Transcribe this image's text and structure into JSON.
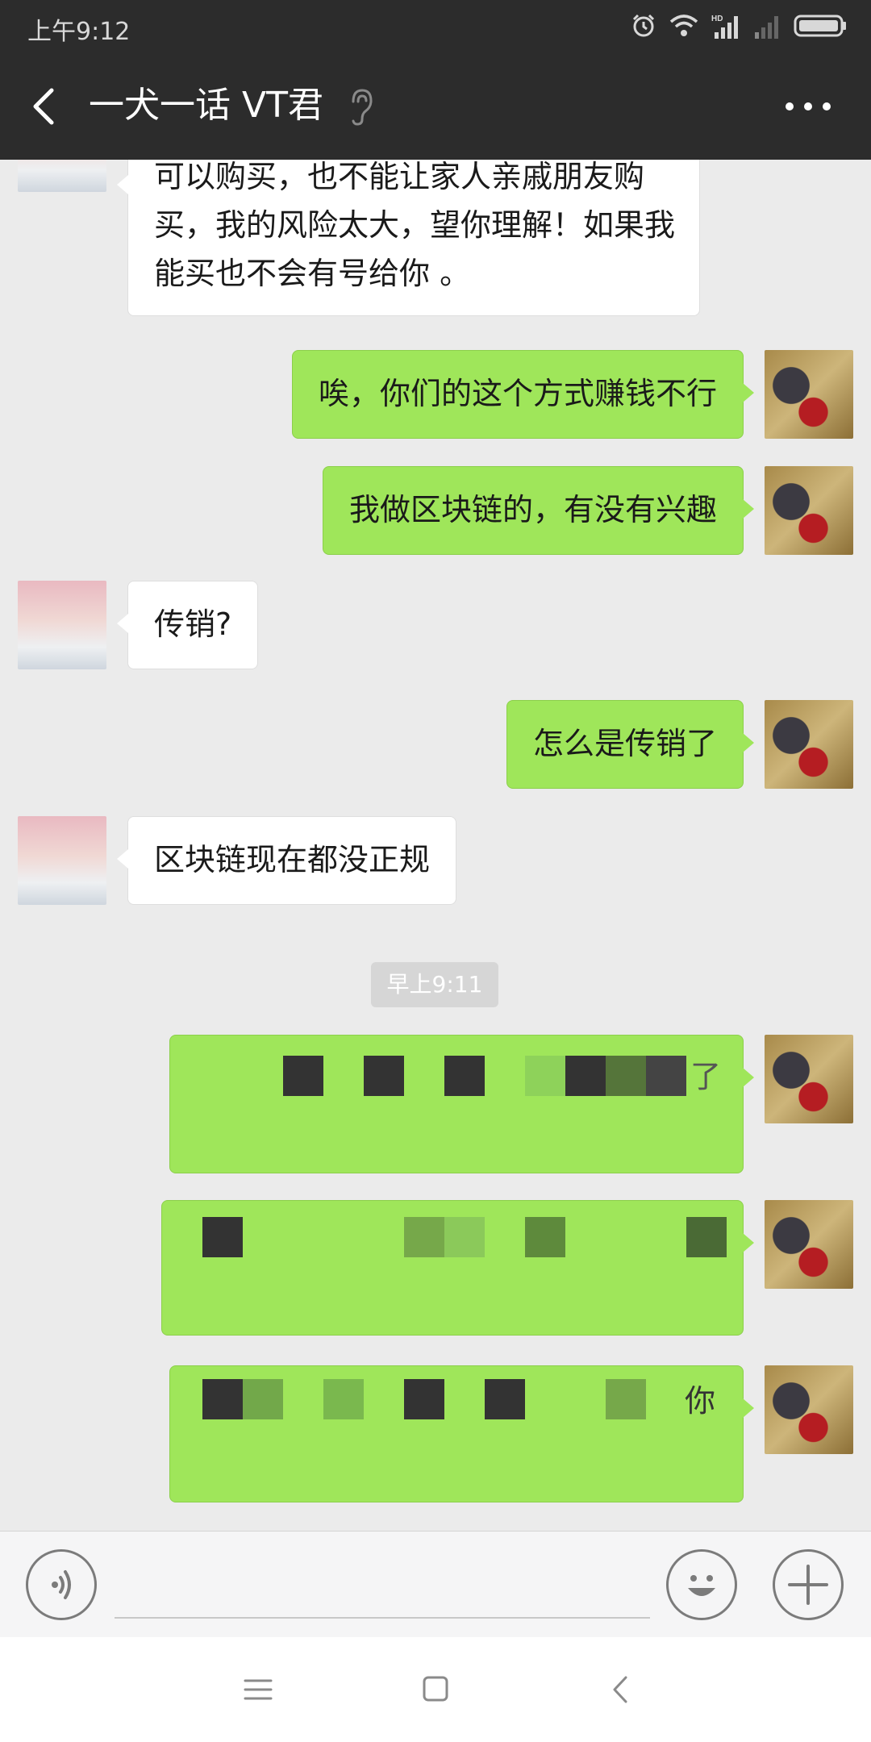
{
  "status_bar": {
    "time": "上午9:12",
    "icons": [
      "alarm-icon",
      "wifi-icon",
      "hd-signal-icon",
      "signal-icon",
      "battery-icon"
    ],
    "hd_label": "HD"
  },
  "title_bar": {
    "title": "一犬一话 VT君",
    "earpiece_icon": "ear-icon",
    "more_icon": "more-icon"
  },
  "messages": [
    {
      "sender": "contact",
      "text": "可以购买，也不能让家人亲戚朋友购买，我的风险太大，望你理解！如果我能买也不会有号给你 。"
    },
    {
      "sender": "me",
      "text": "唉，你们的这个方式赚钱不行"
    },
    {
      "sender": "me",
      "text": "我做区块链的，有没有兴趣"
    },
    {
      "sender": "contact",
      "text": "传销?"
    },
    {
      "sender": "me",
      "text": "怎么是传销了"
    },
    {
      "sender": "contact",
      "text": "区块链现在都没正规"
    },
    {
      "sender": "me",
      "text": "了",
      "pixelated": true
    },
    {
      "sender": "me",
      "text": "",
      "pixelated": true
    },
    {
      "sender": "me",
      "text": "你",
      "pixelated": true
    }
  ],
  "timestamp": "早上9:11",
  "input_bar": {
    "voice_icon": "voice-icon",
    "input_value": "",
    "emoji_icon": "emoji-icon",
    "plus_icon": "plus-icon"
  },
  "nav_bar": {
    "icons": [
      "menu-icon",
      "home-icon",
      "back-icon"
    ]
  },
  "colors": {
    "header_bg": "#2c2c2c",
    "chat_bg": "#ebebeb",
    "outgoing_bubble": "#9fe65a",
    "incoming_bubble": "#ffffff"
  }
}
